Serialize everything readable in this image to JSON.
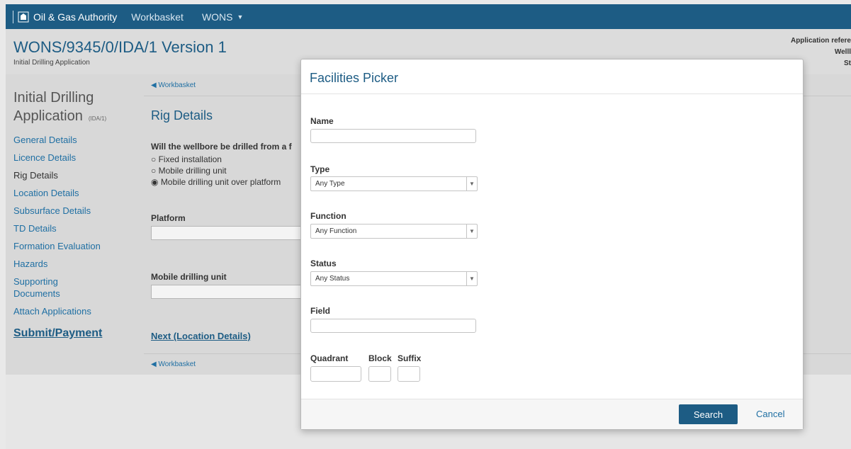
{
  "topbar": {
    "brand": "Oil & Gas Authority",
    "nav": [
      "Workbasket",
      "WONS"
    ]
  },
  "header": {
    "title": "WONS/9345/0/IDA/1 Version 1",
    "subtitle": "Initial Drilling Application",
    "meta": [
      "Application refere",
      "Welll",
      "St"
    ]
  },
  "sidebar": {
    "heading_line1": "Initial Drilling",
    "heading_line2": "Application",
    "heading_suffix": "(IDA/1)",
    "items": [
      {
        "label": "General Details"
      },
      {
        "label": "Licence Details"
      },
      {
        "label": "Rig Details"
      },
      {
        "label": "Location Details"
      },
      {
        "label": "Subsurface Details"
      },
      {
        "label": "TD Details"
      },
      {
        "label": "Formation Evaluation"
      },
      {
        "label": "Hazards"
      },
      {
        "label": "Supporting Documents"
      },
      {
        "label": "Attach Applications"
      }
    ],
    "submit": "Submit/Payment"
  },
  "main": {
    "breadcrumb": "Workbasket",
    "title": "Rig Details",
    "question": "Will the wellbore be drilled from a f",
    "options": [
      {
        "label": "Fixed installation",
        "selected": false
      },
      {
        "label": "Mobile drilling unit",
        "selected": false
      },
      {
        "label": "Mobile drilling unit over platform",
        "selected": true
      }
    ],
    "platform_label": "Platform",
    "mdu_label": "Mobile drilling unit",
    "next_link": "Next (Location Details)"
  },
  "modal": {
    "title": "Facilities Picker",
    "name_label": "Name",
    "name_value": "",
    "type_label": "Type",
    "type_selected": "Any Type",
    "function_label": "Function",
    "function_selected": "Any Function",
    "status_label": "Status",
    "status_selected": "Any Status",
    "field_label": "Field",
    "field_value": "",
    "quadrant_label": "Quadrant",
    "block_label": "Block",
    "suffix_label": "Suffix",
    "search_label": "Search",
    "cancel_label": "Cancel"
  },
  "colors": {
    "brand": "#1d5c84",
    "link": "#1f6fa3"
  }
}
